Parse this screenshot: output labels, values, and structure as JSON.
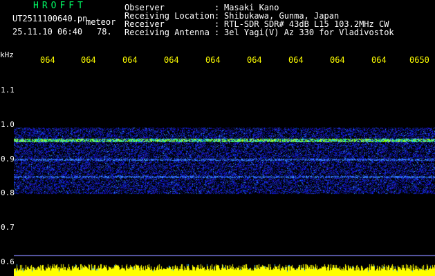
{
  "header": {
    "app_title": "HROFFT",
    "file_name": "UT2511100640.pn",
    "mode": "meteor",
    "datetime": "25.11.10 06:40",
    "count": "78."
  },
  "info": [
    {
      "label": "Observer",
      "sep": ":",
      "value": "Masaki Kano"
    },
    {
      "label": "Receiving Location",
      "sep": ":",
      "value": "Shibukawa, Gunma, Japan"
    },
    {
      "label": "Receiver",
      "sep": ":",
      "value": "RTL-SDR SDR# 43dB L15 103.2MHz CW"
    },
    {
      "label": "Receiving Antenna",
      "sep": ":",
      "value": "3el Yagi(V) Az 330 for Vladivostok"
    }
  ],
  "axis": {
    "unit": "kHz",
    "time_ticks": [
      "064",
      "064",
      "064",
      "064",
      "064",
      "064",
      "064",
      "064",
      "064",
      "0650"
    ],
    "freq_ticks": [
      "1.1",
      "1.0",
      "0.9",
      "0.8",
      "0.7",
      "0.6"
    ],
    "freq_range_khz": [
      0.58,
      1.14
    ]
  },
  "colors": {
    "title": "#00ff66",
    "ticks": "#ffff00",
    "text": "#ffffff",
    "background": "#000000",
    "noise": "#1a2bd0",
    "signal_line": "#7dff00",
    "level_bar": "#ffff00",
    "marker_line": "#8888ff"
  },
  "spectrogram": {
    "band_low_khz": 0.8,
    "band_high_khz": 0.99,
    "main_signal_khz": 0.955,
    "secondary_signals_khz": [
      0.9,
      0.85
    ],
    "marker_khz": 0.62
  }
}
